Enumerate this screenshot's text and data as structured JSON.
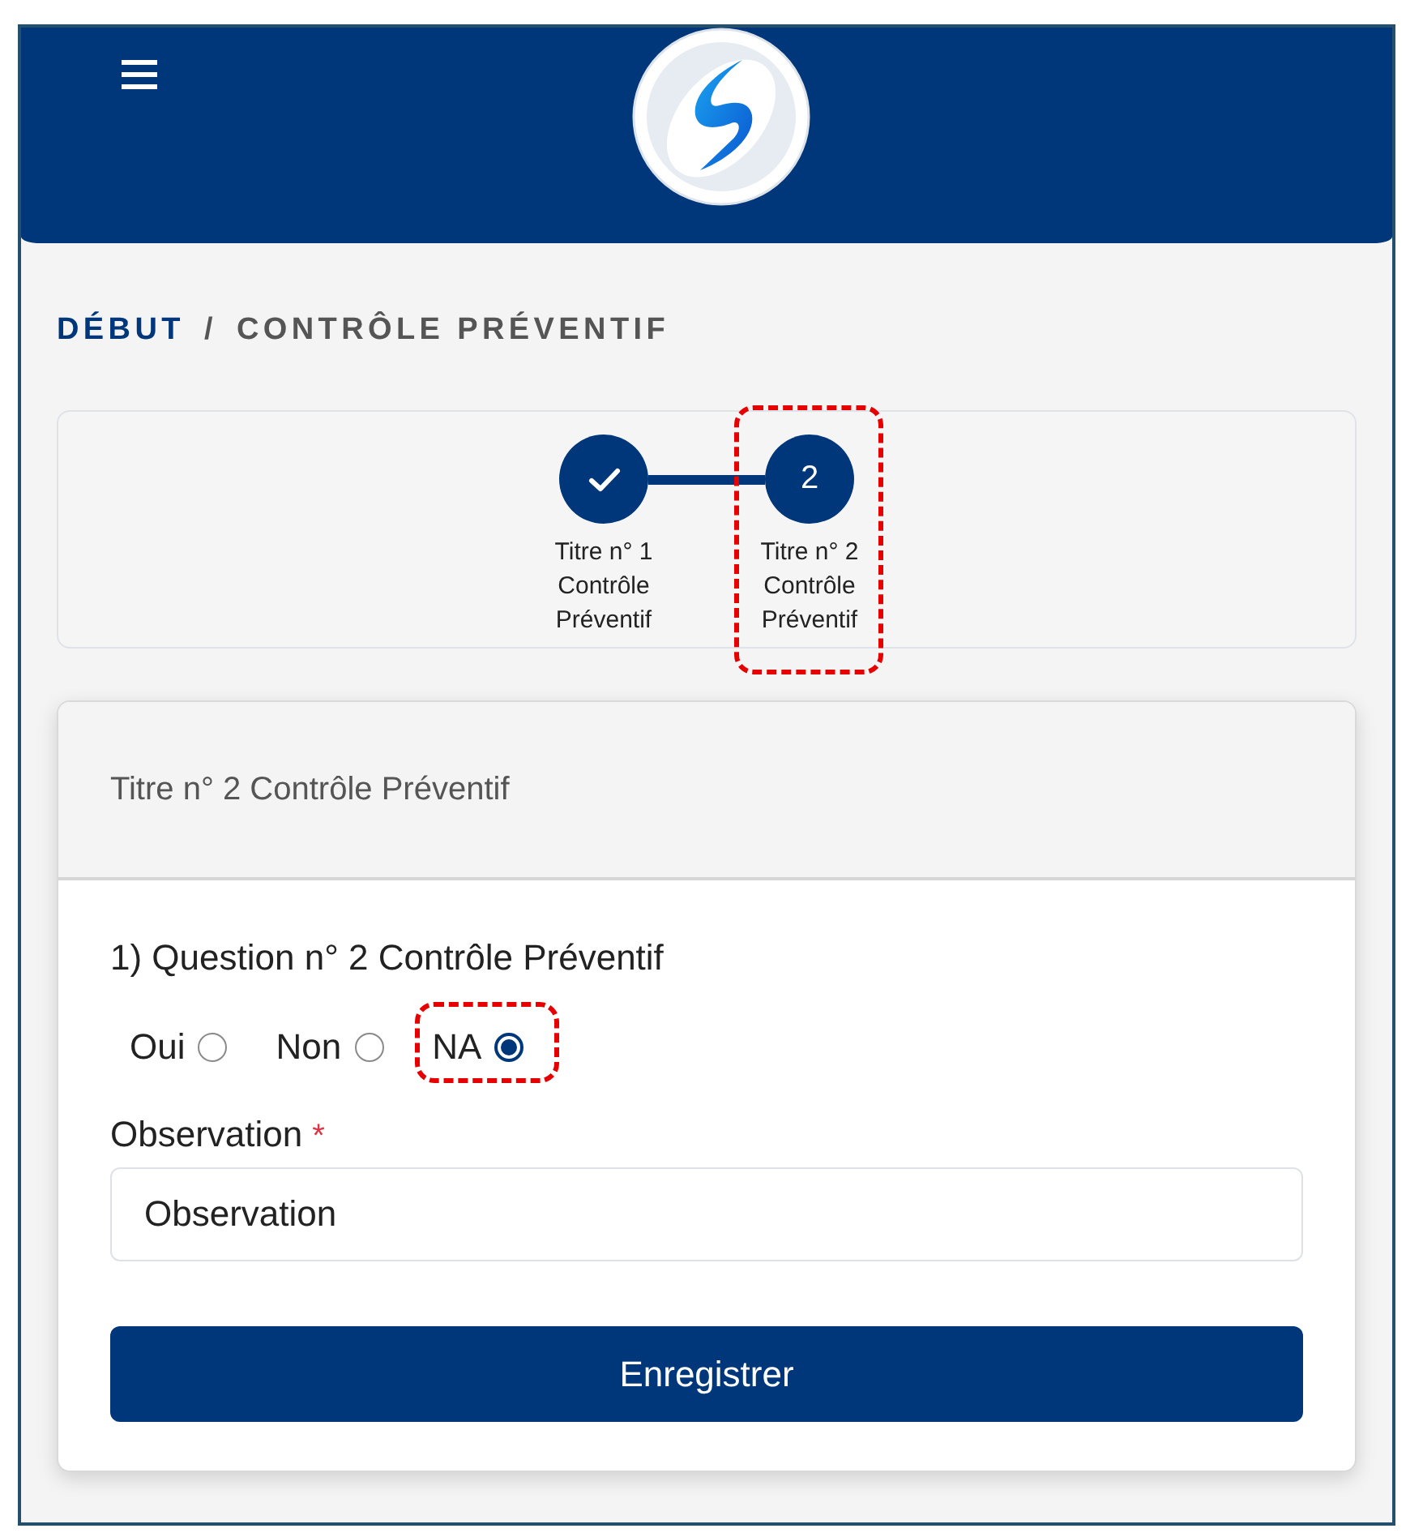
{
  "breadcrumb": {
    "items": [
      {
        "label": "DÉBUT",
        "kind": "link"
      },
      {
        "label": "CONTRÔLE PRÉVENTIF",
        "kind": "current"
      }
    ],
    "separator": "/"
  },
  "stepper": {
    "steps": [
      {
        "label": "Titre n° 1 Contrôle Préventif",
        "done": true,
        "highlighted": false
      },
      {
        "label": "Titre n° 2 Contrôle Préventif",
        "done": false,
        "number": "2",
        "highlighted": true
      }
    ]
  },
  "section": {
    "title": "Titre n° 2 Contrôle Préventif",
    "question": "1) Question n° 2 Contrôle Préventif",
    "options": [
      {
        "label": "Oui",
        "selected": false,
        "highlighted": false
      },
      {
        "label": "Non",
        "selected": false,
        "highlighted": false
      },
      {
        "label": "NA",
        "selected": true,
        "highlighted": true
      }
    ],
    "observation": {
      "label": "Observation",
      "required_mark": "*",
      "value": "Observation"
    },
    "submit": "Enregistrer"
  }
}
